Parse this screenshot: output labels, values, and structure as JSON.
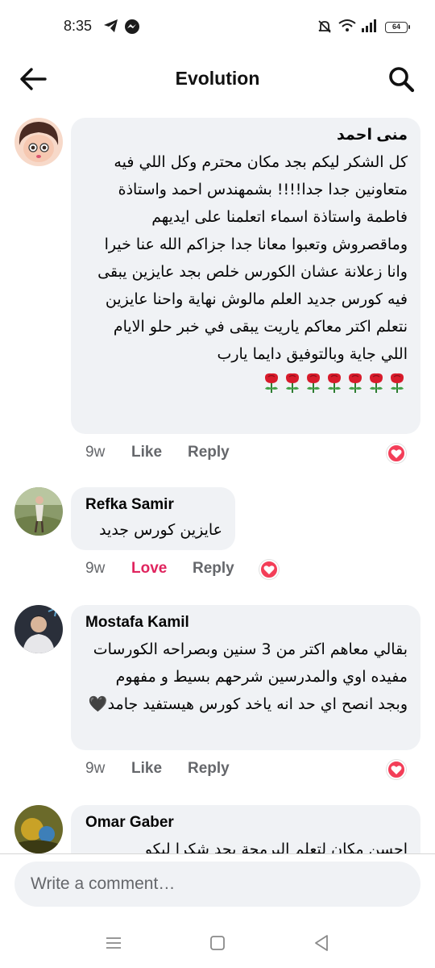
{
  "status_bar": {
    "time": "8:35",
    "battery": "64",
    "icons": [
      "telegram-icon",
      "messenger-icon",
      "mute-icon",
      "wifi-icon",
      "signal-icon",
      "battery-icon"
    ]
  },
  "header": {
    "title": "Evolution",
    "back_icon": "back-arrow-icon",
    "search_icon": "search-icon"
  },
  "comments": [
    {
      "author": "منى احمد",
      "text": "كل الشكر ليكم بجد مكان محترم وكل اللي فيه متعاونين جدا جدا!!!! بشمهندس احمد واستاذة فاطمة واستاذة اسماء اتعلمنا على ايديهم وماقصروش وتعبوا معانا جدا جزاكم الله عنا خيرا\nوانا زعلانة عشان الكورس خلص بجد عايزين يبقى فيه كورس جديد العلم مالوش نهاية واحنا عايزين نتعلم اكتر معاكم ياريت يبقى في خبر حلو الايام اللي جاية وبالتوفيق دايما يارب",
      "rose_count": 7,
      "time": "9w",
      "like_label": "Like",
      "reply_label": "Reply",
      "reaction_count": "1",
      "reaction": "love"
    },
    {
      "author": "Refka Samir",
      "text": "عايزين كورس جديد",
      "time": "9w",
      "like_label": "Love",
      "reply_label": "Reply",
      "reaction_count": "1",
      "reaction": "love"
    },
    {
      "author": "Mostafa Kamil",
      "text": "بقالي معاهم اكتر من 3 سنين وبصراحه الكورسات مفيده اوي والمدرسين شرحهم بسيط و مفهوم وبجد انصح اي حد انه ياخد كورس هيستفيد جامد🖤",
      "time": "9w",
      "like_label": "Like",
      "reply_label": "Reply",
      "reaction_count": "1",
      "reaction": "love"
    },
    {
      "author": "Omar Gaber",
      "text": "احسن مكان لتعلم البرمجة بجد شكرا ليكو"
    }
  ],
  "composer": {
    "placeholder": "Write a comment…"
  },
  "nav": {
    "icons": [
      "menu-icon",
      "home-icon",
      "back-icon"
    ]
  },
  "colors": {
    "bubble": "#f0f2f5",
    "love": "#e0245e",
    "meta": "#65676b"
  }
}
